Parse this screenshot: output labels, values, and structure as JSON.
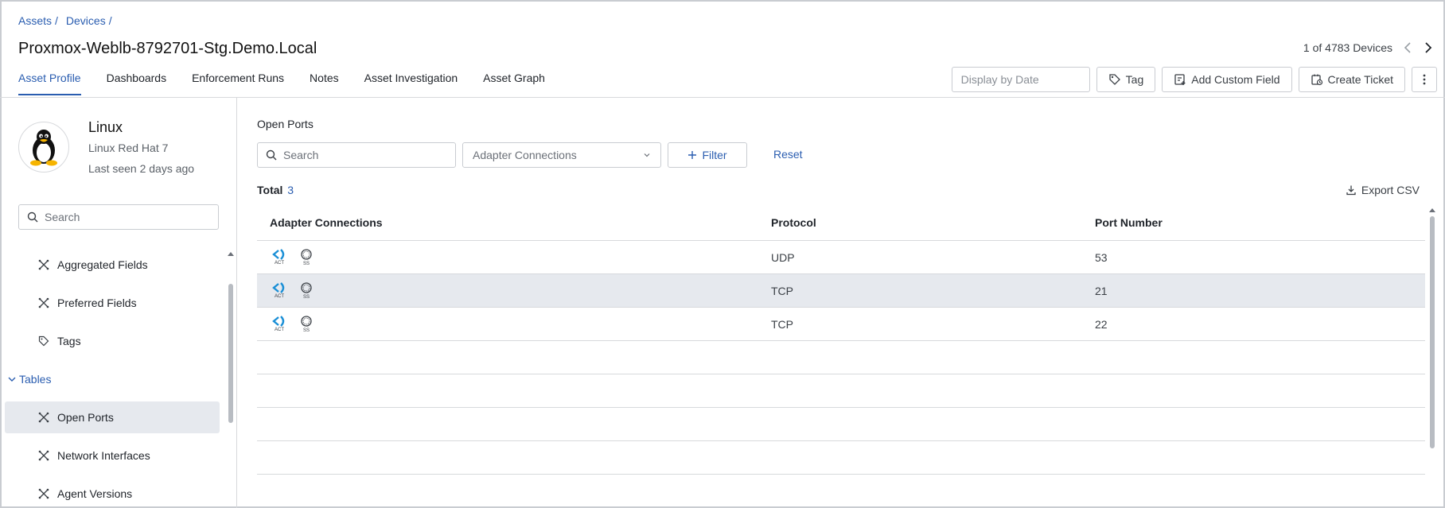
{
  "breadcrumb": [
    {
      "label": "Assets"
    },
    {
      "label": "Devices"
    }
  ],
  "title": "Proxmox-Weblb-8792701-Stg.Demo.Local",
  "pager": {
    "text": "1 of 4783 Devices"
  },
  "tabs": [
    {
      "label": "Asset Profile",
      "active": true
    },
    {
      "label": "Dashboards"
    },
    {
      "label": "Enforcement Runs"
    },
    {
      "label": "Notes"
    },
    {
      "label": "Asset Investigation"
    },
    {
      "label": "Asset Graph"
    }
  ],
  "toolbar": {
    "date_placeholder": "Display by Date",
    "tag_label": "Tag",
    "custom_field_label": "Add Custom Field",
    "ticket_label": "Create Ticket"
  },
  "sidebar": {
    "os_name": "Linux",
    "os_version": "Linux Red Hat 7",
    "last_seen": "Last seen 2 days ago",
    "search_placeholder": "Search",
    "items": [
      {
        "label": "Aggregated Fields",
        "icon": "fields-icon"
      },
      {
        "label": "Preferred Fields",
        "icon": "fields-icon"
      },
      {
        "label": "Tags",
        "icon": "tag-icon"
      }
    ],
    "group_label": "Tables",
    "table_items": [
      {
        "label": "Open Ports",
        "active": true
      },
      {
        "label": "Network Interfaces"
      },
      {
        "label": "Agent Versions"
      }
    ]
  },
  "main": {
    "section_title": "Open Ports",
    "search_placeholder": "Search",
    "adapter_select": "Adapter Connections",
    "filter_label": "Filter",
    "reset_label": "Reset",
    "total_label": "Total",
    "total_count": "3",
    "export_label": "Export CSV",
    "columns": [
      "Adapter Connections",
      "Protocol",
      "Port Number"
    ],
    "rows": [
      {
        "adapters": [
          "ACT",
          "SS"
        ],
        "protocol": "UDP",
        "port": "53"
      },
      {
        "adapters": [
          "ACT",
          "SS"
        ],
        "protocol": "TCP",
        "port": "21"
      },
      {
        "adapters": [
          "ACT",
          "SS"
        ],
        "protocol": "TCP",
        "port": "22"
      }
    ]
  },
  "colors": {
    "accent": "#2a5db0",
    "row_highlight": "#e6e9ee",
    "border": "#c9ccd1"
  }
}
